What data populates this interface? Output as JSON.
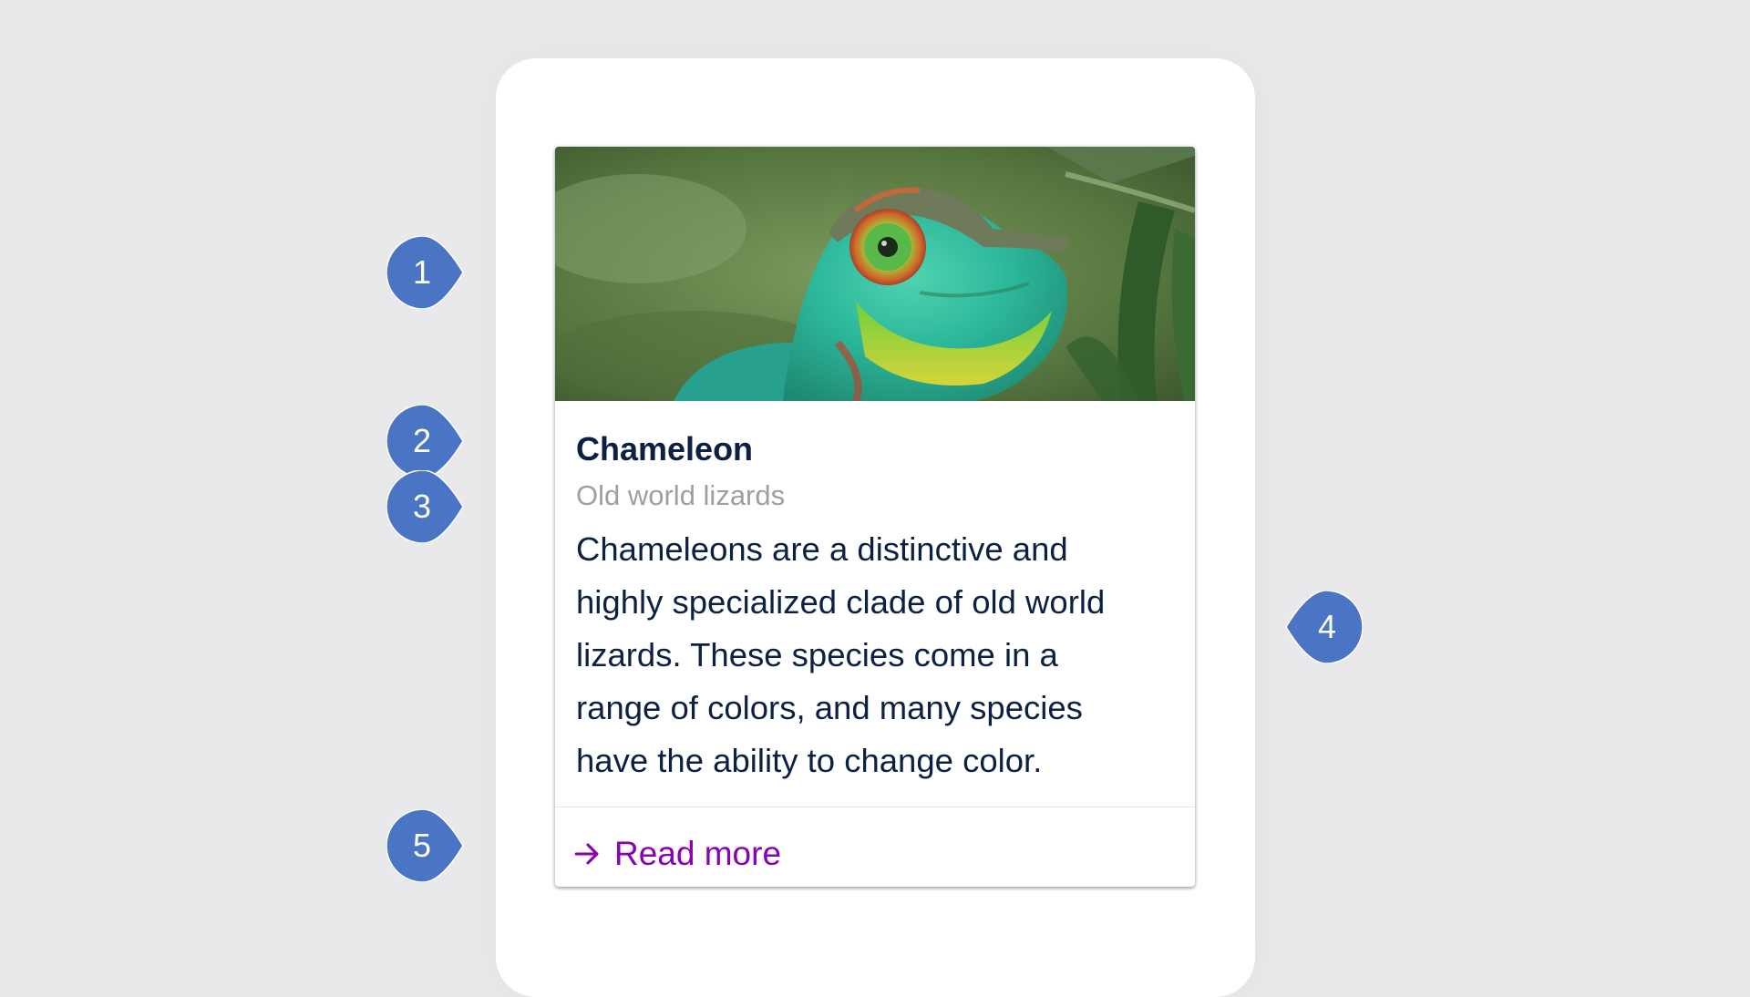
{
  "card": {
    "title": "Chameleon",
    "subtitle": "Old world lizards",
    "body_lines": [
      "Chameleons are a distinctive and",
      "highly specialized clade of old world",
      "lizards. These species come in a",
      "range of colors, and many species",
      "have the ability to change color."
    ],
    "action_label": "Read more",
    "action_icon": "arrow-right-icon",
    "image_subject": "chameleon-photo"
  },
  "callouts": [
    {
      "number": "1",
      "points_to": "card-image"
    },
    {
      "number": "2",
      "points_to": "card-title"
    },
    {
      "number": "3",
      "points_to": "card-subtitle"
    },
    {
      "number": "4",
      "points_to": "card-container"
    },
    {
      "number": "5",
      "points_to": "read-more-button"
    }
  ],
  "colors": {
    "background": "#e9e9eb",
    "title": "#0c2142",
    "subtitle": "#9e9fa3",
    "action": "#8a00b3",
    "callout": "#4a74c4"
  }
}
